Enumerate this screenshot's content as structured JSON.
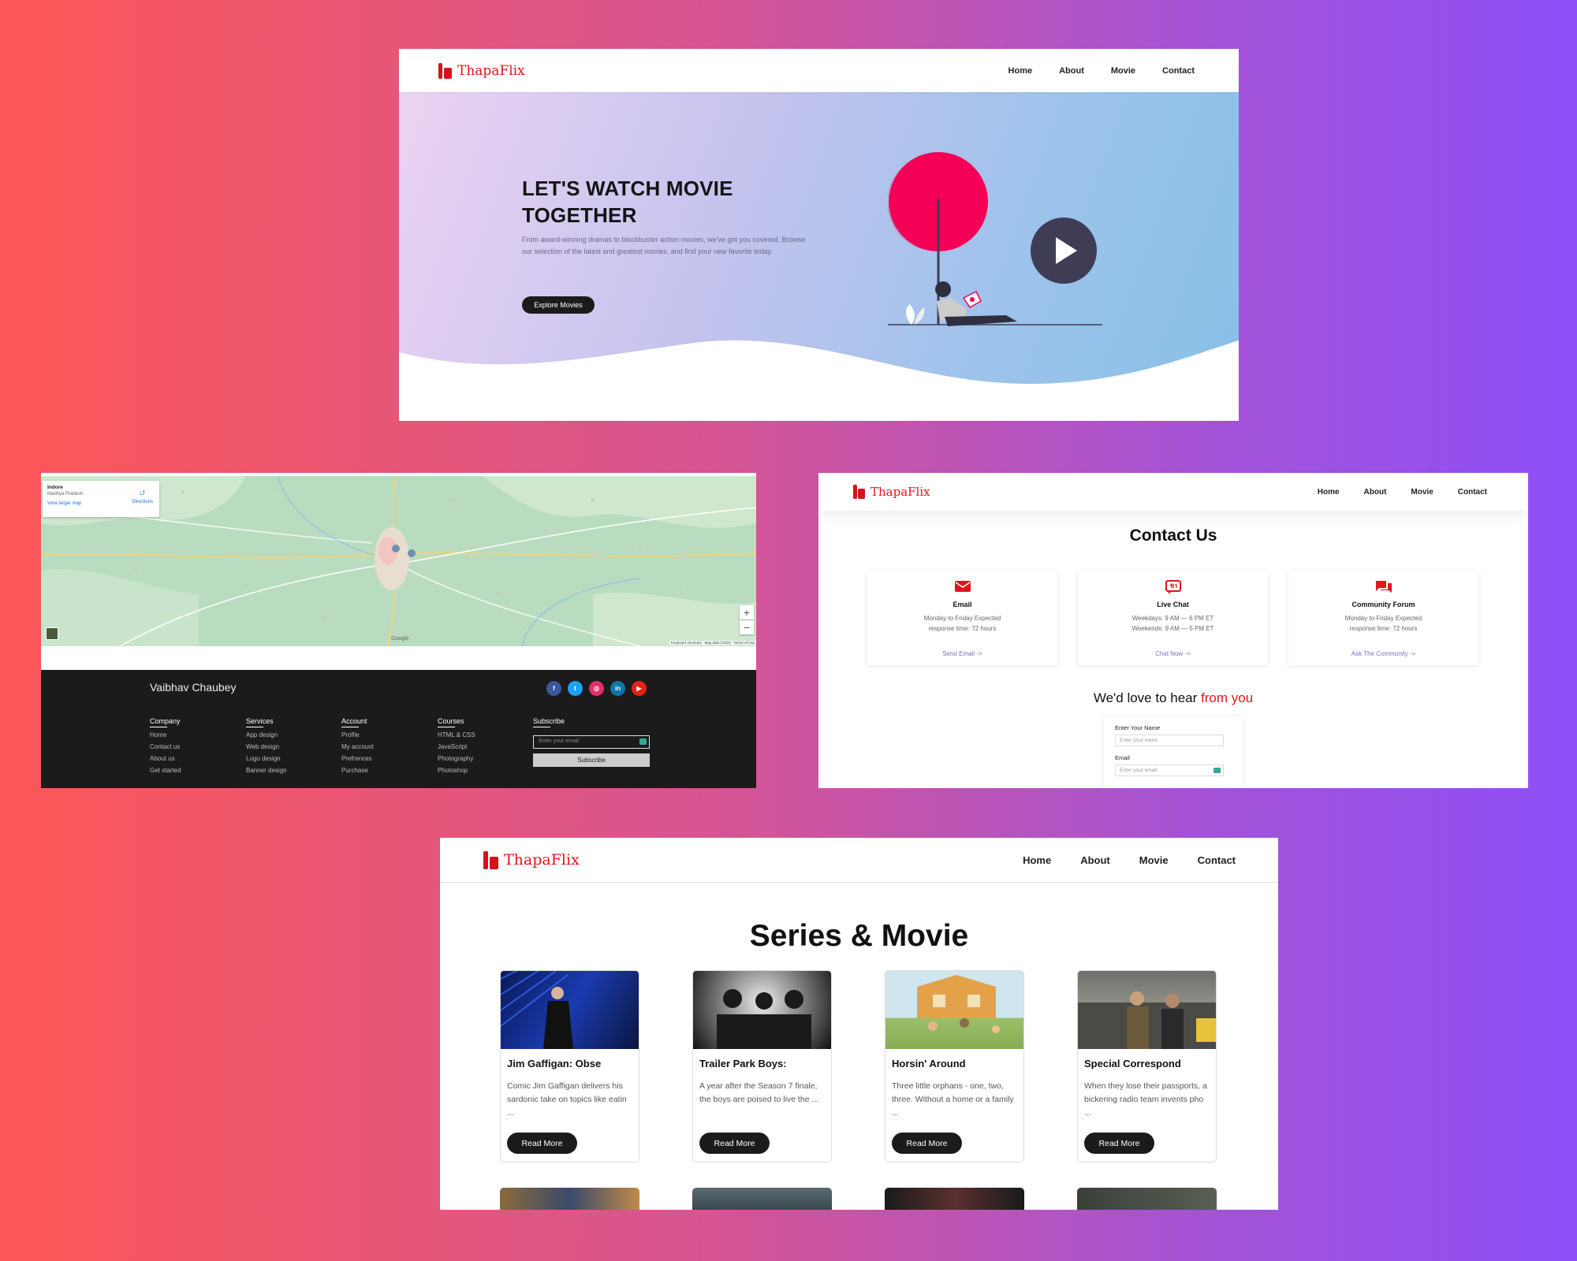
{
  "brand": "ThapaFlix",
  "nav": [
    "Home",
    "About",
    "Movie",
    "Contact"
  ],
  "hero": {
    "title": "LET'S WATCH MOVIE TOGETHER",
    "text": "From award-winning dramas to blockbuster action movies, we've got you covered. Browse our selection of the latest and greatest movies, and find your new favorite today.",
    "button": "Explore Movies"
  },
  "map": {
    "place": "Indore",
    "region": "Madhya Pradesh",
    "directions": "Directions",
    "larger_link": "View larger map",
    "zoom_in": "+",
    "zoom_out": "−",
    "attribution": "Keyboard shortcuts   Map data ©2023   Terms of Use",
    "google": "Google"
  },
  "footer": {
    "name": "Vaibhav Chaubey",
    "socials": [
      {
        "icon": "facebook-icon",
        "glyph": "f",
        "color": "#3b5998"
      },
      {
        "icon": "twitter-icon",
        "glyph": "t",
        "color": "#1da1f2"
      },
      {
        "icon": "instagram-icon",
        "glyph": "◎",
        "color": "#e1306c"
      },
      {
        "icon": "linkedin-icon",
        "glyph": "in",
        "color": "#0e76a8"
      },
      {
        "icon": "youtube-icon",
        "glyph": "▶",
        "color": "#e62117"
      }
    ],
    "columns": [
      {
        "title": "Company",
        "links": [
          "Home",
          "Contact us",
          "About us",
          "Get started"
        ]
      },
      {
        "title": "Services",
        "links": [
          "App design",
          "Web design",
          "Logo design",
          "Banner design"
        ]
      },
      {
        "title": "Account",
        "links": [
          "Profile",
          "My account",
          "Prefrences",
          "Purchase"
        ]
      },
      {
        "title": "Courses",
        "links": [
          "HTML & CSS",
          "JavaScript",
          "Photography",
          "Photoshop"
        ]
      }
    ],
    "subscribe_title": "Subscribe",
    "subscribe_placeholder": "Enter your email",
    "subscribe_button": "Subscribe"
  },
  "contact": {
    "title": "Contact Us",
    "cards": [
      {
        "icon": "email-icon",
        "title": "Email",
        "lines": [
          "Monday to Friday Expected",
          "response time: 72 hours"
        ],
        "action": "Send Email ->"
      },
      {
        "icon": "live-chat-icon",
        "title": "Live Chat",
        "lines": [
          "Weekdays: 9 AM — 6 PM ET",
          "Weekends: 9 AM — 5 PM ET"
        ],
        "action": "Chat Now ->"
      },
      {
        "icon": "community-forum-icon",
        "title": "Community Forum",
        "lines": [
          "Monday to Friday Expected",
          "response time: 72 hours"
        ],
        "action": "Ask The Community ->"
      }
    ],
    "love_prefix": "We'd love to hear ",
    "love_highlight": "from you",
    "form": {
      "name_label": "Enter Your Name",
      "name_placeholder": "Enter your name",
      "email_label": "Email",
      "email_placeholder": "Enter your email"
    }
  },
  "series": {
    "title": "Series & Movie",
    "read_more": "Read More",
    "cards": [
      {
        "title": "Jim Gaffigan: Obse",
        "desc": "Comic Jim Gaffigan delivers his sardonic take on topics like eatin ..."
      },
      {
        "title": "Trailer Park Boys:",
        "desc": "A year after the Season 7 finale, the boys are poised to live the ..."
      },
      {
        "title": "Horsin' Around",
        "desc": "Three little orphans - one, two, three. Without a home or a family ..."
      },
      {
        "title": "Special Correspond",
        "desc": "When they lose their passports, a bickering radio team invents pho ..."
      }
    ]
  },
  "colors": {
    "brand_red": "#e3151c",
    "dark": "#1b1b1b",
    "play_button": "#3f3d56",
    "accent_pink": "#f50057"
  }
}
